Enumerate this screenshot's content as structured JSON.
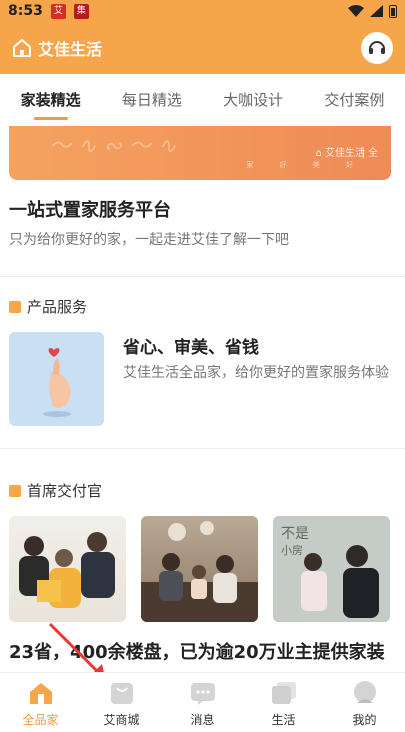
{
  "status_bar": {
    "time": "8:53",
    "notif1": "艾",
    "notif2": "集"
  },
  "app_bar": {
    "title": "艾佳生活",
    "home_icon": "home-icon",
    "service_icon": "headset-icon"
  },
  "tabs": [
    {
      "label": "家装精选",
      "active": true
    },
    {
      "label": "每日精选",
      "active": false
    },
    {
      "label": "大咖设计",
      "active": false
    },
    {
      "label": "交付案例",
      "active": false
    }
  ],
  "banner": {
    "brand": "艾佳生活",
    "brand_suffix": "全",
    "tagline": "家 好 美 好"
  },
  "intro": {
    "title": "一站式置家服务平台",
    "subtitle": "只为给你更好的家，一起走进艾佳了解一下吧"
  },
  "product_section": {
    "header": "产品服务",
    "title": "省心、审美、省钱",
    "description": "艾佳生活全品家，给你更好的置家服务体验"
  },
  "delivery_section": {
    "header": "首席交付官",
    "headline": "23省，400余楼盘，已为逾20万业主提供家装"
  },
  "bottom_nav": [
    {
      "label": "全品家",
      "icon": "home-icon",
      "active": true
    },
    {
      "label": "艾商城",
      "icon": "shopping-bag-icon",
      "active": false
    },
    {
      "label": "消息",
      "icon": "message-icon",
      "active": false
    },
    {
      "label": "生活",
      "icon": "life-cards-icon",
      "active": false
    },
    {
      "label": "我的",
      "icon": "profile-icon",
      "active": false
    }
  ],
  "colors": {
    "brand": "#f7a54a",
    "accent": "#f39a3a",
    "annotation_arrow": "#e53935"
  }
}
